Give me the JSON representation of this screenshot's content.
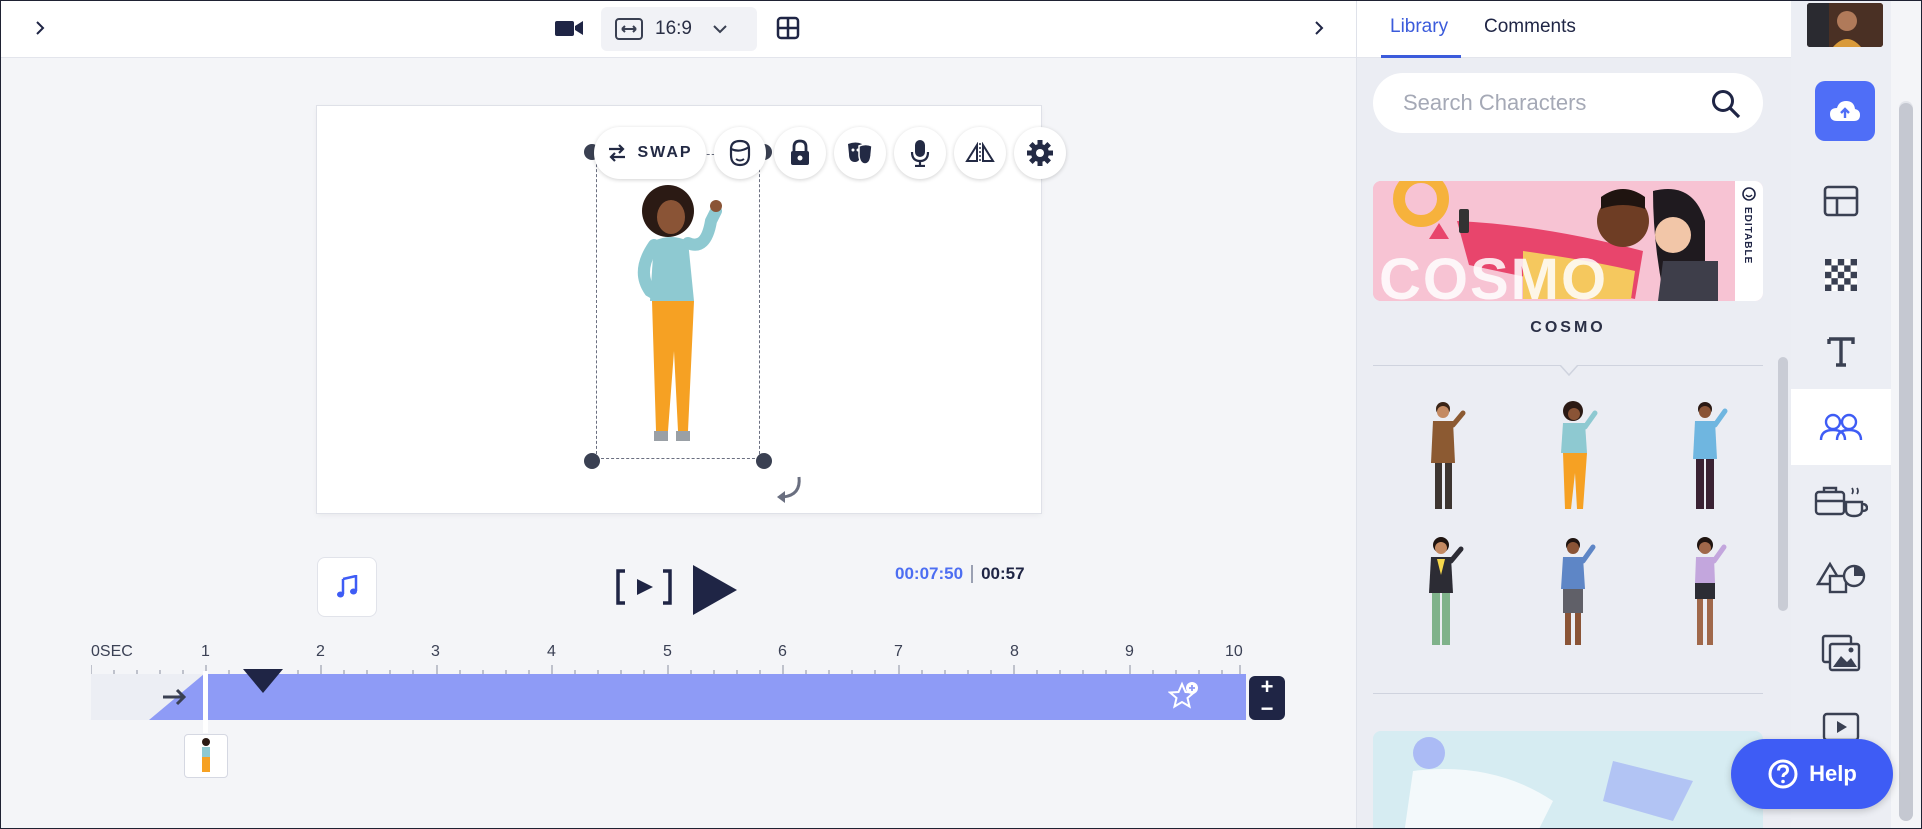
{
  "topbar": {
    "aspect_ratio": "16:9"
  },
  "toolbar": {
    "swap_label": "SWAP"
  },
  "playback": {
    "current_time": "00:07:50",
    "total_time": "00:57"
  },
  "timeline": {
    "ticks": [
      "0SEC",
      "1",
      "2",
      "3",
      "4",
      "5",
      "6",
      "7",
      "8",
      "9",
      "10"
    ],
    "zoom_in": "+",
    "zoom_out": "−"
  },
  "panel": {
    "tabs": [
      {
        "label": "Library",
        "active": true
      },
      {
        "label": "Comments",
        "active": false
      }
    ],
    "search_placeholder": "Search Characters",
    "pack_name": "COSMO",
    "banner_text": "COSMO",
    "banner_badge": "EDITABLE"
  },
  "rail": {
    "items": [
      "upload-icon",
      "layout-icon",
      "background-icon",
      "text-icon",
      "characters-icon",
      "props-icon",
      "shapes-icon",
      "media-icon",
      "video-icon"
    ]
  },
  "help": {
    "label": "Help"
  },
  "colors": {
    "accent": "#4f6ef7",
    "timeline_fill": "#8e9bf6",
    "dark": "#1f2545"
  }
}
